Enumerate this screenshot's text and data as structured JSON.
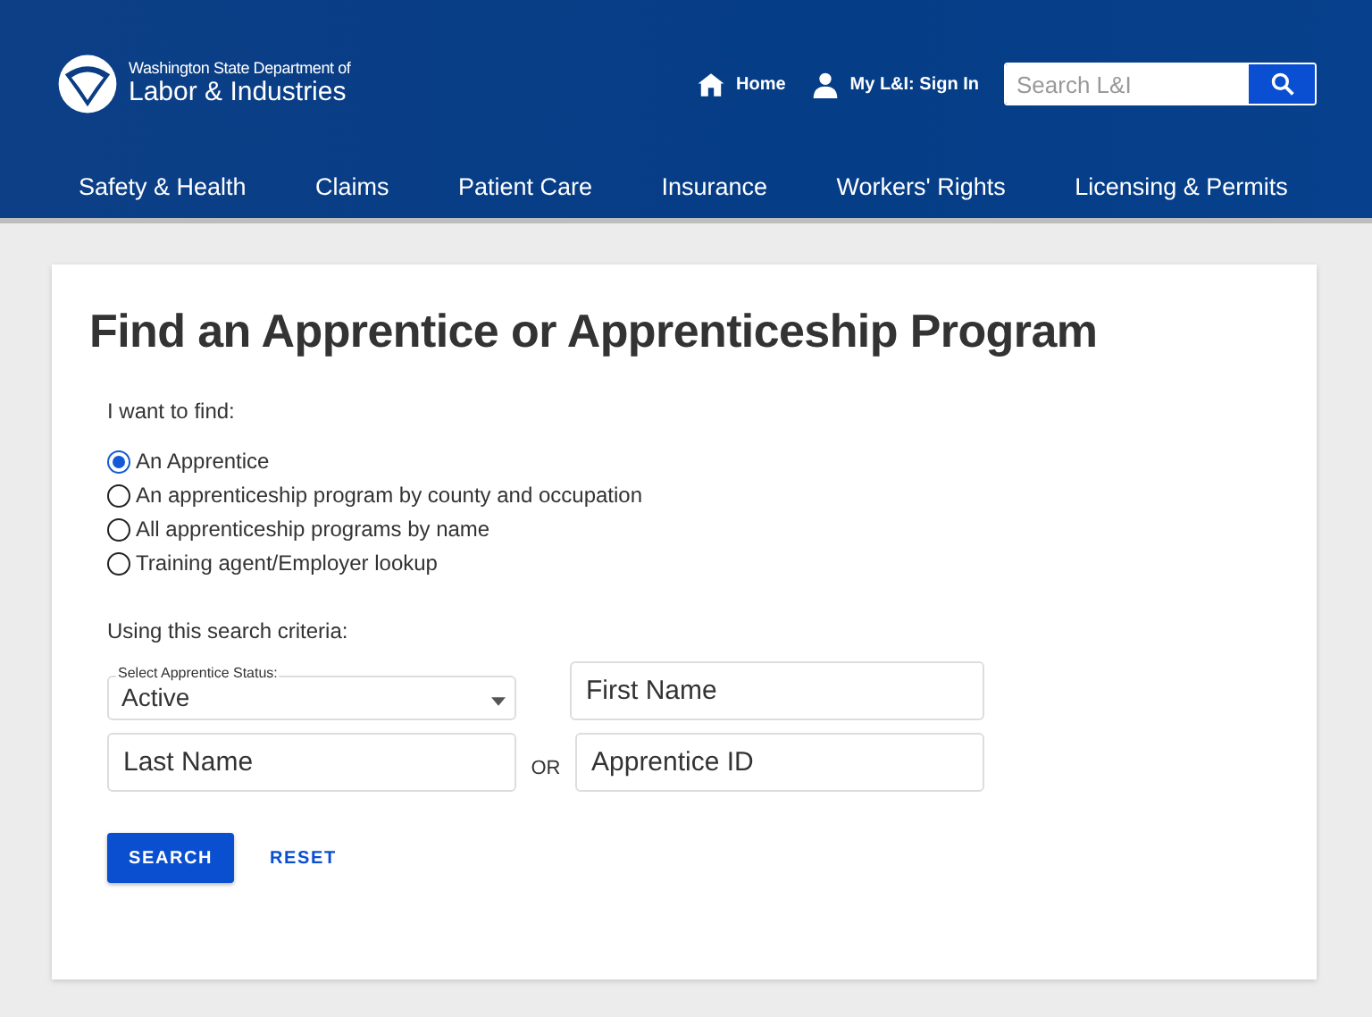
{
  "header": {
    "agency_line1": "Washington State Department of",
    "agency_line2": "Labor & Industries",
    "links": [
      {
        "kind": "home",
        "label": "Home"
      },
      {
        "kind": "user",
        "label": "My L&I: Sign In"
      }
    ],
    "search": {
      "placeholder": "Search L&I"
    },
    "nav": [
      "Safety & Health",
      "Claims",
      "Patient Care",
      "Insurance",
      "Workers' Rights",
      "Licensing & Permits"
    ]
  },
  "page": {
    "title": "Find an Apprentice or Apprenticeship Program",
    "find_label": "I want to find:",
    "options": [
      {
        "label": "An Apprentice",
        "selected": true
      },
      {
        "label": "An apprenticeship program by county and occupation",
        "selected": false
      },
      {
        "label": "All apprenticeship programs by name",
        "selected": false
      },
      {
        "label": "Training agent/Employer lookup",
        "selected": false
      }
    ],
    "criteria_label": "Using this search criteria:",
    "status_select": {
      "label": "Select Apprentice Status:",
      "value": "Active"
    },
    "first_name": {
      "placeholder": "First Name"
    },
    "last_name": {
      "placeholder": "Last Name"
    },
    "or_text": "OR",
    "apprentice_id": {
      "placeholder": "Apprentice ID"
    },
    "buttons": [
      {
        "kind": "primary",
        "label": "SEARCH"
      },
      {
        "kind": "link",
        "label": "RESET"
      }
    ]
  }
}
